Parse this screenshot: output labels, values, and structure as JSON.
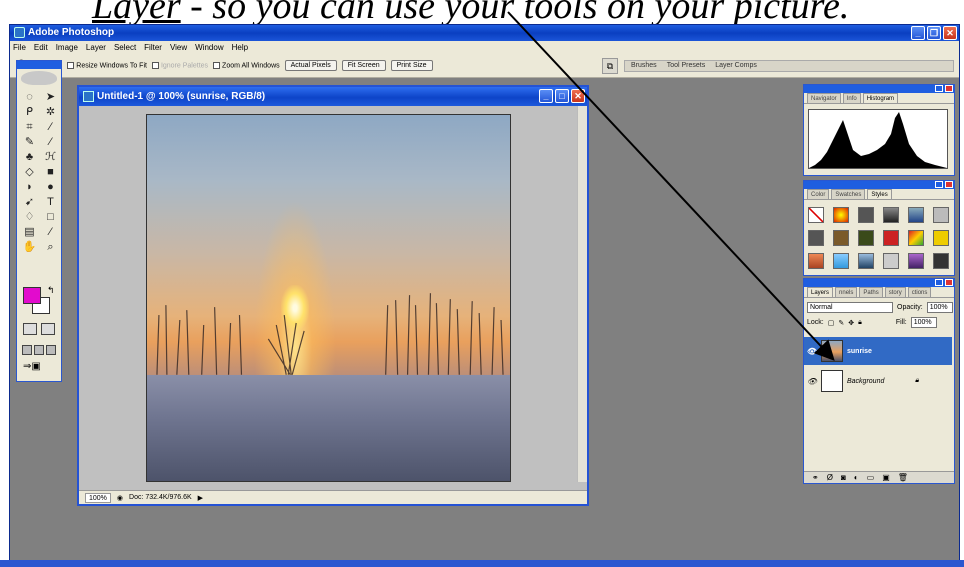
{
  "caption": {
    "underlined": "Layer",
    "rest": " - so you can use your tools on your picture."
  },
  "app": {
    "title": "Adobe Photoshop",
    "menu": [
      "File",
      "Edit",
      "Image",
      "Layer",
      "Select",
      "Filter",
      "View",
      "Window",
      "Help"
    ],
    "options": {
      "resize_windows": "Resize Windows To Fit",
      "ignore_palettes": "Ignore Palettes",
      "zoom_all": "Zoom All Windows",
      "actual_pixels": "Actual Pixels",
      "fit_screen": "Fit Screen",
      "print_size": "Print Size"
    },
    "palette_well": [
      "Brushes",
      "Tool Presets",
      "Layer Comps"
    ]
  },
  "document": {
    "title": "Untitled-1 @ 100% (sunrise, RGB/8)",
    "zoom": "100%",
    "doc_size": "Doc: 732.4K/976.6K"
  },
  "navigator_palette": {
    "tabs": [
      "Navigator",
      "Info",
      "Histogram"
    ],
    "active": "Histogram"
  },
  "color_palette": {
    "tabs": [
      "Color",
      "Swatches",
      "Styles"
    ],
    "active": "Styles"
  },
  "layers_palette": {
    "tabs": [
      "Layers",
      "nnels",
      "Paths",
      "story",
      "ctions"
    ],
    "blend_mode": "Normal",
    "opacity_label": "Opacity:",
    "opacity": "100%",
    "lock_label": "Lock:",
    "fill_label": "Fill:",
    "fill": "100%",
    "layers": [
      {
        "name": "sunrise",
        "active": true
      },
      {
        "name": "Background",
        "active": false
      }
    ]
  },
  "colors": {
    "foreground": "#e20bcd",
    "background": "#ffffff",
    "title_blue": "#0a3fc1"
  }
}
